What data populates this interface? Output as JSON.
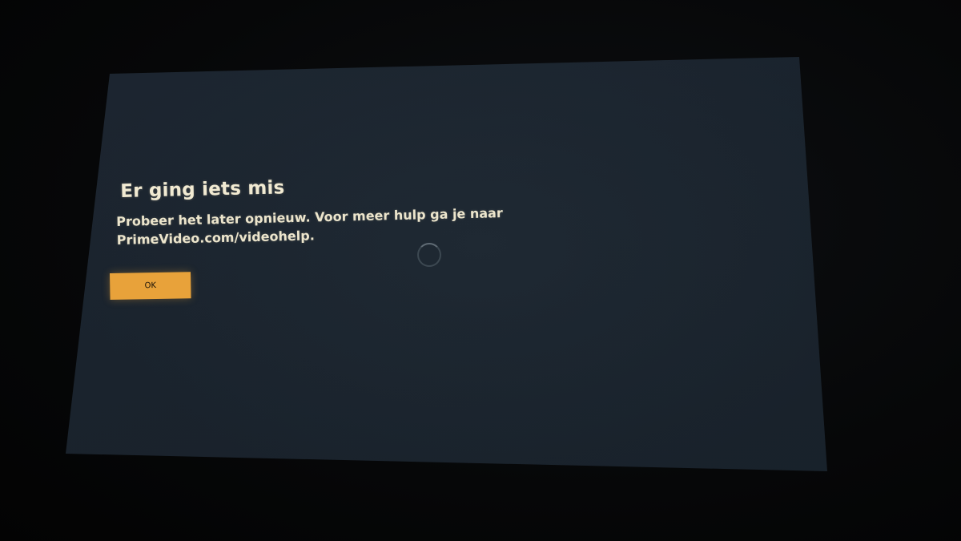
{
  "dialog": {
    "title": "Er ging iets mis",
    "message_line1": "Probeer het later opnieuw. Voor meer hulp ga je naar",
    "message_line2": "PrimeVideo.com/videohelp.",
    "ok_label": "OK"
  },
  "colors": {
    "screen_background": "#1b242e",
    "accent_button": "#e8a23a",
    "text": "#ece5cc"
  },
  "icons": {
    "loading": "spinner-icon"
  }
}
